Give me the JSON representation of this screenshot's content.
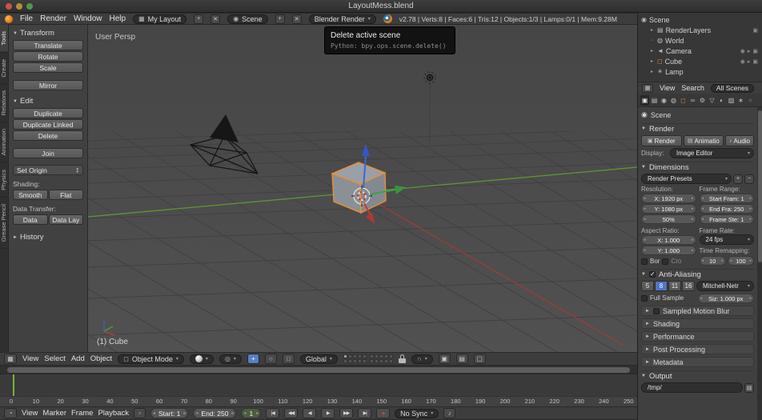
{
  "window": {
    "title": "LayoutMess.blend"
  },
  "infobar": {
    "menus": [
      "File",
      "Render",
      "Window",
      "Help"
    ],
    "layout": "My Layout",
    "scene": "Scene",
    "engine": "Blender Render",
    "stats": "v2.78 | Verts:8 | Faces:6 | Tris:12 | Objects:1/3 | Lamps:0/1 | Mem:9.28M"
  },
  "tooltip": {
    "title": "Delete active scene",
    "python": "Python: bpy.ops.scene.delete()"
  },
  "toolshelf": {
    "tabs": [
      "Tools",
      "Create",
      "Relations",
      "Animation",
      "Physics",
      "Grease Pencil"
    ],
    "transform_title": "Transform",
    "transform_buttons": [
      "Translate",
      "Rotate",
      "Scale",
      "Mirror"
    ],
    "edit_title": "Edit",
    "edit_buttons": [
      "Duplicate",
      "Duplicate Linked",
      "Delete",
      "Join"
    ],
    "set_origin": "Set Origin",
    "shading_label": "Shading:",
    "shading_buttons": [
      "Smooth",
      "Flat"
    ],
    "data_transfer_label": "Data Transfer:",
    "data_buttons": [
      "Data",
      "Data Lay"
    ],
    "history_title": "History"
  },
  "viewport": {
    "view_label": "User Persp",
    "object_label": "(1) Cube",
    "header": {
      "menus": [
        "View",
        "Select",
        "Add",
        "Object"
      ],
      "mode": "Object Mode",
      "orientation": "Global"
    }
  },
  "timeline": {
    "menus": [
      "View",
      "Marker",
      "Frame",
      "Playback"
    ],
    "start": "Start: 1",
    "end": "End: 250",
    "current": "1",
    "sync": "No Sync",
    "ticks": [
      0,
      10,
      20,
      30,
      40,
      50,
      60,
      70,
      80,
      90,
      100,
      110,
      120,
      130,
      140,
      150,
      160,
      170,
      180,
      190,
      200,
      210,
      220,
      230,
      240,
      250
    ]
  },
  "outliner": {
    "rows": [
      {
        "label": "Scene"
      },
      {
        "label": "RenderLayers"
      },
      {
        "label": "World"
      },
      {
        "label": "Camera"
      },
      {
        "label": "Cube"
      },
      {
        "label": "Lamp"
      }
    ],
    "header_menus": [
      "View",
      "Search"
    ],
    "display_mode": "All Scenes"
  },
  "properties": {
    "context": "Scene",
    "render": {
      "title": "Render",
      "buttons": [
        "Render",
        "Animatio",
        "Audio"
      ],
      "display_label": "Display:",
      "display_value": "Image Editor"
    },
    "dimensions": {
      "title": "Dimensions",
      "presets": "Render Presets",
      "resolution_label": "Resolution:",
      "frame_range_label": "Frame Range:",
      "res_x": "X: 1920 px",
      "res_y": "Y: 1080 px",
      "res_pct": "50%",
      "frame_start": "Start Fram: 1",
      "frame_end": "End Fra: 250",
      "frame_step": "Frame Ste: 1",
      "aspect_label": "Aspect Ratio:",
      "aspect_x": "X: 1.000",
      "aspect_y": "Y: 1.000",
      "fps_label": "Frame Rate:",
      "fps": "24 fps",
      "remap_label": "Time Remapping:",
      "remap_a": "10",
      "remap_b": "100",
      "border": "Bor",
      "crop": "Cro"
    },
    "aa": {
      "title": "Anti-Aliasing",
      "samples": [
        "5",
        "8",
        "11",
        "16"
      ],
      "filter": "Mitchell-Netr",
      "full_sample": "Full Sample",
      "size": "Siz: 1.000 px"
    },
    "panels": [
      "Sampled Motion Blur",
      "Shading",
      "Performance",
      "Post Processing",
      "Metadata"
    ],
    "output_title": "Output",
    "output_path": "/tmp/"
  }
}
